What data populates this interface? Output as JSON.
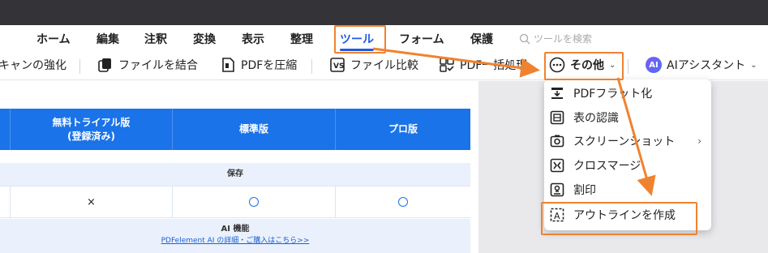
{
  "menubar": {
    "items": [
      {
        "label": "ホーム"
      },
      {
        "label": "編集"
      },
      {
        "label": "注釈"
      },
      {
        "label": "変換"
      },
      {
        "label": "表示"
      },
      {
        "label": "整理"
      },
      {
        "label": "ツール",
        "active": true
      },
      {
        "label": "フォーム"
      },
      {
        "label": "保護"
      }
    ],
    "search_placeholder": "ツールを検索"
  },
  "toolbar": {
    "scan_enhance": "キャンの強化",
    "combine": "ファイルを結合",
    "compress": "PDFを圧縮",
    "compare": "ファイル比較",
    "batch": "PDF一括処理",
    "other": "その他",
    "ai_assistant": "AIアシスタント",
    "ai_badge": "AI"
  },
  "table": {
    "headers": [
      "無料トライアル版\n(登録済み)",
      "標準版",
      "プロ版"
    ],
    "section_save": "保存",
    "row_values": [
      "×",
      "○",
      "○"
    ],
    "section_ai": "AI 機能",
    "ai_link": "PDFelement AI の詳細・ご購入はこちら>>"
  },
  "dropdown": {
    "items": [
      {
        "label": "PDFフラット化",
        "icon": "flatten-icon"
      },
      {
        "label": "表の認識",
        "icon": "table-recognition-icon"
      },
      {
        "label": "スクリーンショット",
        "icon": "screenshot-icon",
        "submenu": true
      },
      {
        "label": "クロスマージ",
        "icon": "cross-merge-icon"
      },
      {
        "label": "割印",
        "icon": "seal-icon"
      },
      {
        "label": "アウトラインを作成",
        "icon": "outline-icon"
      }
    ]
  },
  "colors": {
    "accent": "#1e5be6",
    "table_header": "#1a73e8",
    "highlight": "#f0822f",
    "titlebar": "#343438"
  }
}
